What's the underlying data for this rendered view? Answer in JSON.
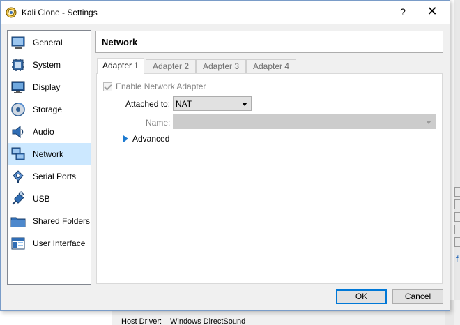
{
  "window": {
    "title": "Kali Clone - Settings",
    "help": "?",
    "close": "✕"
  },
  "sidebar": {
    "items": [
      {
        "label": "General",
        "icon": "general-icon"
      },
      {
        "label": "System",
        "icon": "system-icon"
      },
      {
        "label": "Display",
        "icon": "display-icon"
      },
      {
        "label": "Storage",
        "icon": "storage-icon"
      },
      {
        "label": "Audio",
        "icon": "audio-icon"
      },
      {
        "label": "Network",
        "icon": "network-icon",
        "selected": true
      },
      {
        "label": "Serial Ports",
        "icon": "serial-ports-icon"
      },
      {
        "label": "USB",
        "icon": "usb-icon"
      },
      {
        "label": "Shared Folders",
        "icon": "shared-folders-icon"
      },
      {
        "label": "User Interface",
        "icon": "user-interface-icon"
      }
    ]
  },
  "page": {
    "title": "Network"
  },
  "tabs": [
    {
      "label": "Adapter 1",
      "active": true
    },
    {
      "label": "Adapter 2"
    },
    {
      "label": "Adapter 3"
    },
    {
      "label": "Adapter 4"
    }
  ],
  "adapter": {
    "enable_label": "Enable Network Adapter",
    "attached_label": "Attached to:",
    "attached_value": "NAT",
    "name_label": "Name:",
    "name_value": "",
    "advanced_label": "Advanced"
  },
  "buttons": {
    "ok": "OK",
    "cancel": "Cancel"
  },
  "background": {
    "host_driver_label": "Host Driver:",
    "host_driver_value": "Windows DirectSound",
    "edge_glyph": "f"
  },
  "colors": {
    "selection": "#cce8ff",
    "accent": "#0078d7"
  }
}
